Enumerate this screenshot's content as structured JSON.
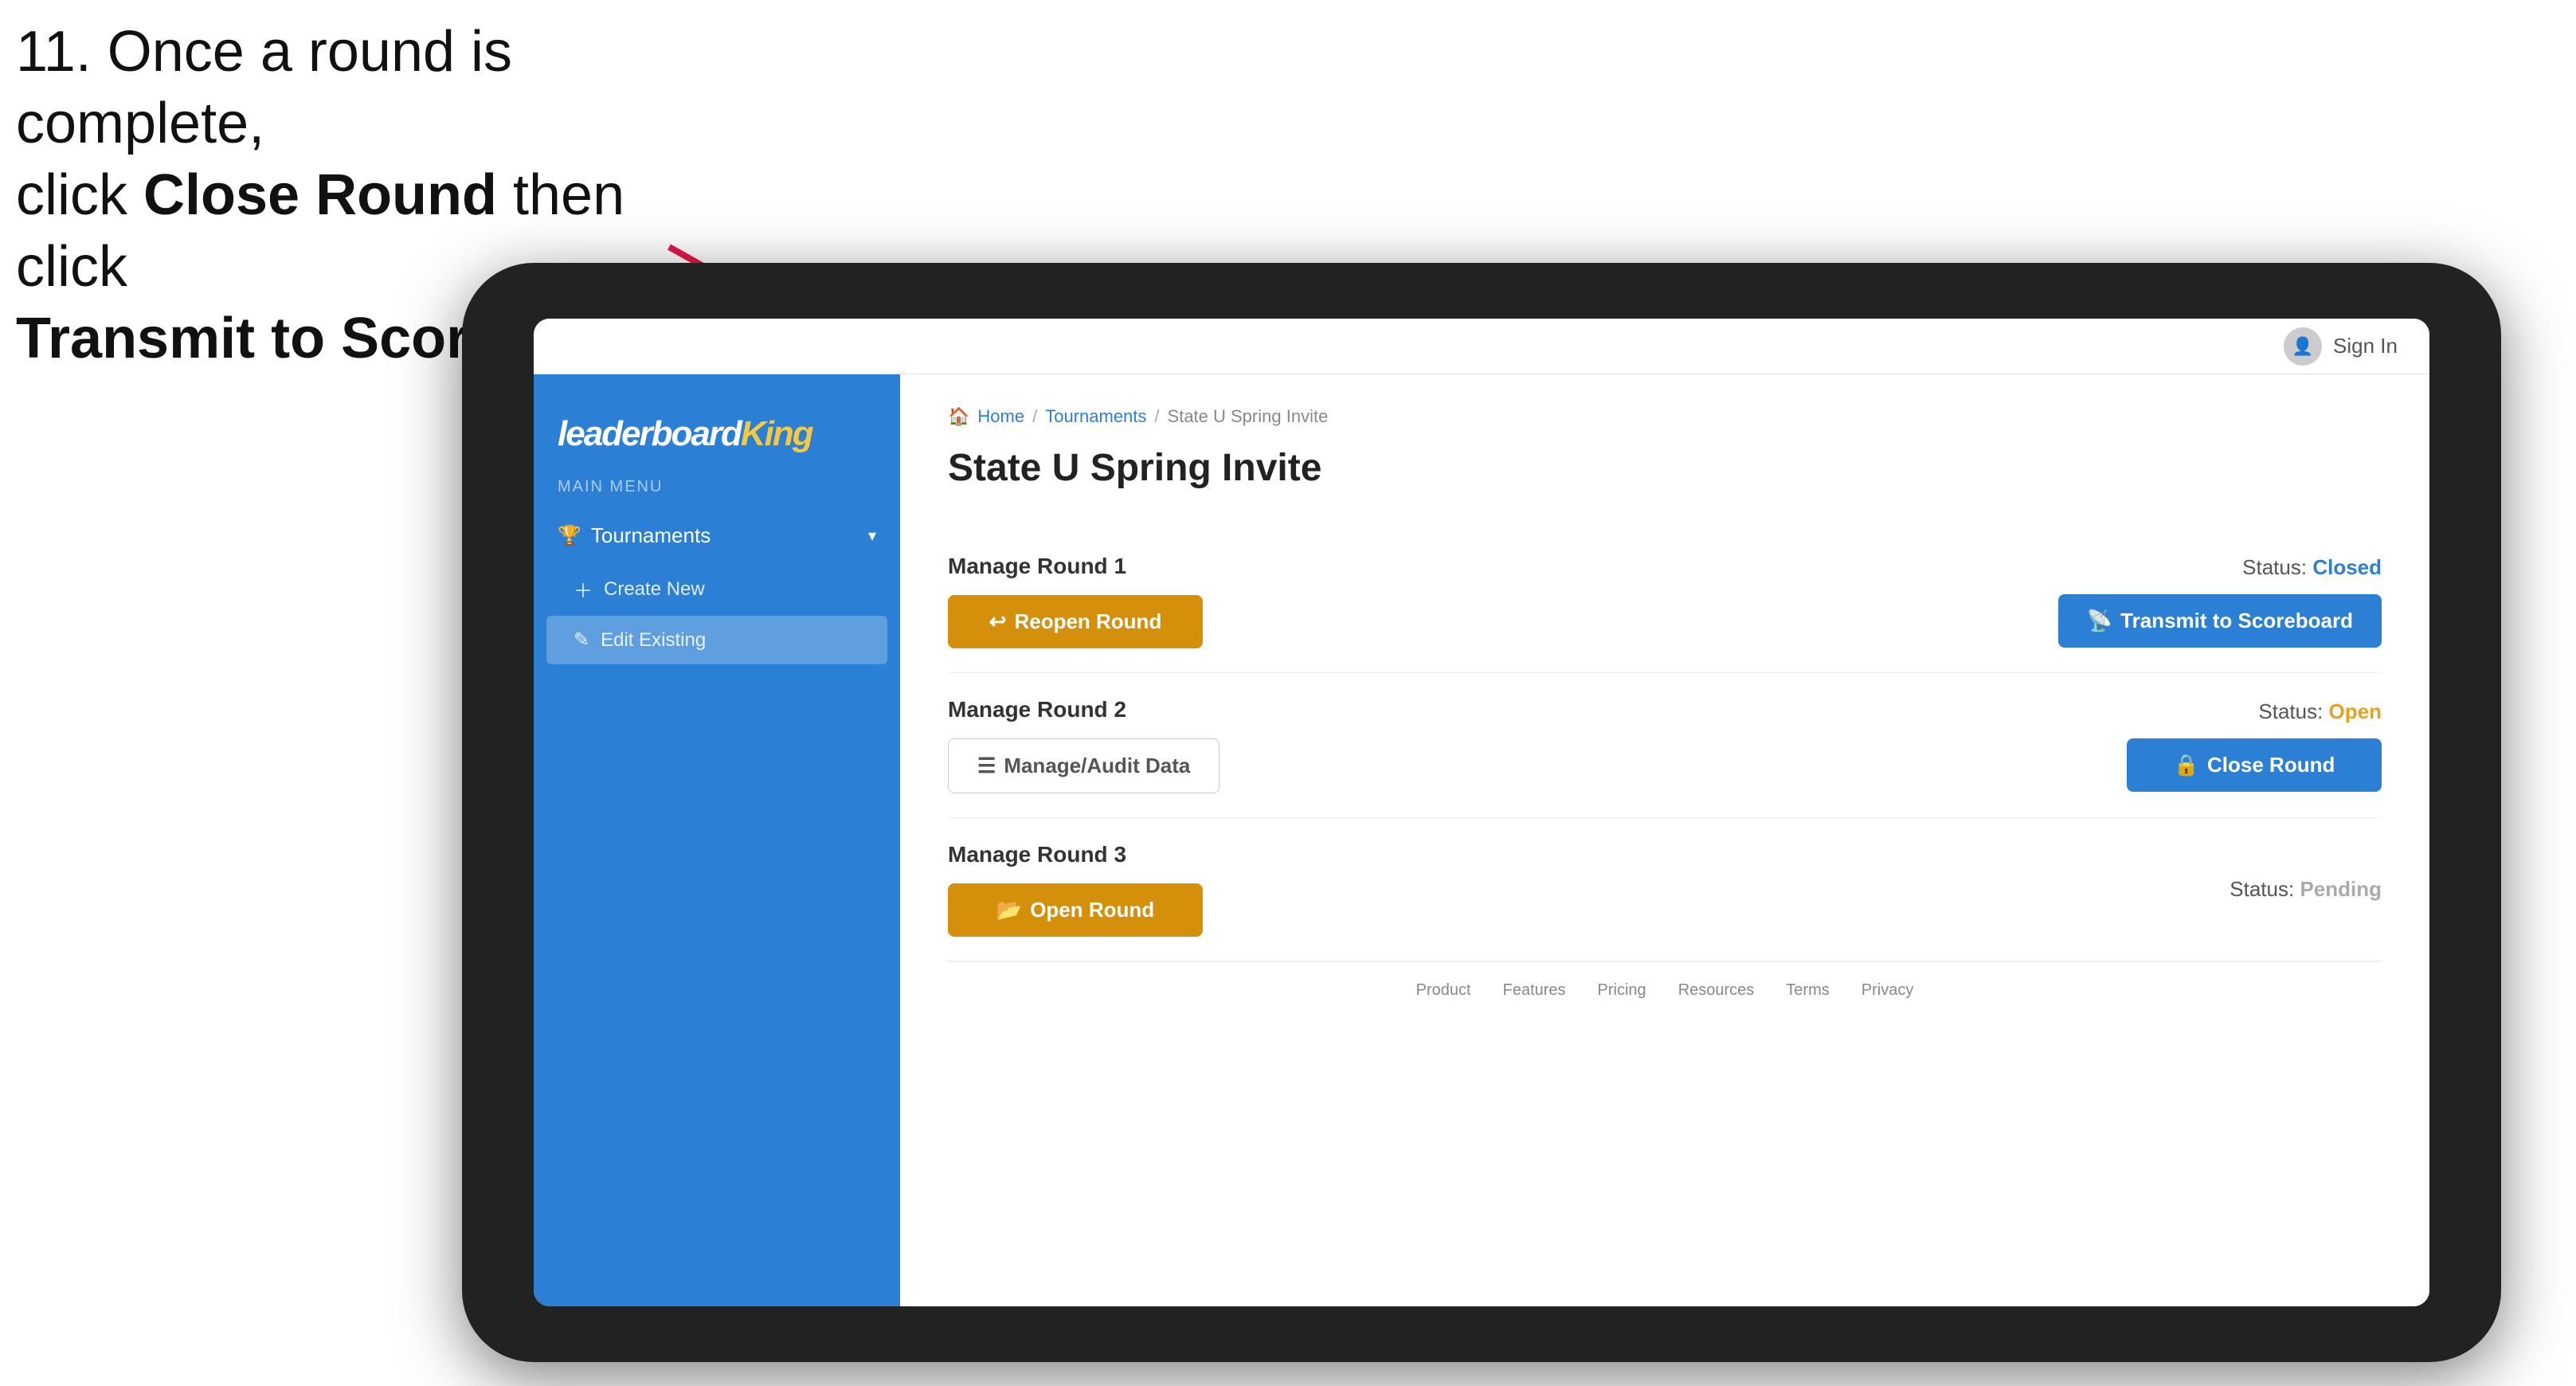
{
  "instruction": {
    "line1": "11. Once a round is complete,",
    "line2": "click ",
    "bold1": "Close Round",
    "line3": " then click",
    "bold2": "Transmit to Scoreboard."
  },
  "topbar": {
    "sign_in_label": "Sign In"
  },
  "logo": {
    "leaderboard": "leaderboard",
    "king": "King"
  },
  "sidebar": {
    "main_menu_label": "MAIN MENU",
    "tournaments_label": "Tournaments",
    "create_new_label": "Create New",
    "edit_existing_label": "Edit Existing"
  },
  "breadcrumb": {
    "home": "Home",
    "tournaments": "Tournaments",
    "current": "State U Spring Invite"
  },
  "page": {
    "title": "State U Spring Invite"
  },
  "rounds": [
    {
      "id": "round-1",
      "title": "Manage Round 1",
      "status_label": "Status:",
      "status_value": "Closed",
      "status_type": "closed",
      "left_button": "Reopen Round",
      "right_button": "Transmit to Scoreboard",
      "left_btn_type": "gold",
      "right_btn_type": "blue"
    },
    {
      "id": "round-2",
      "title": "Manage Round 2",
      "status_label": "Status:",
      "status_value": "Open",
      "status_type": "open",
      "left_button": "Manage/Audit Data",
      "right_button": "Close Round",
      "left_btn_type": "outline",
      "right_btn_type": "blue"
    },
    {
      "id": "round-3",
      "title": "Manage Round 3",
      "status_label": "Status:",
      "status_value": "Pending",
      "status_type": "pending",
      "left_button": "Open Round",
      "right_button": null,
      "left_btn_type": "gold"
    }
  ],
  "footer": {
    "links": [
      "Product",
      "Features",
      "Pricing",
      "Resources",
      "Terms",
      "Privacy"
    ]
  }
}
